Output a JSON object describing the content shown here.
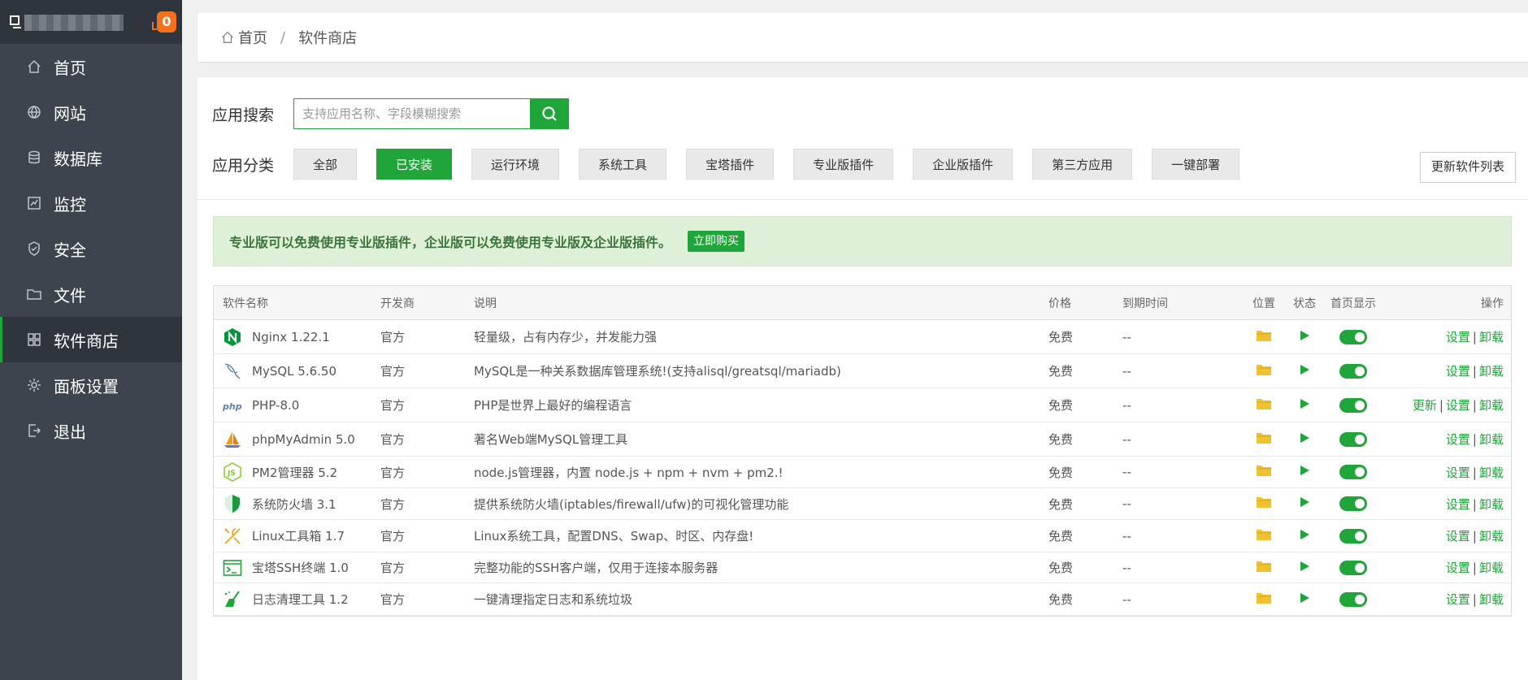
{
  "sidebar": {
    "notification_count": "0",
    "items": [
      {
        "label": "首页",
        "icon": "home-icon"
      },
      {
        "label": "网站",
        "icon": "globe-icon"
      },
      {
        "label": "数据库",
        "icon": "database-icon"
      },
      {
        "label": "监控",
        "icon": "monitor-chart-icon"
      },
      {
        "label": "安全",
        "icon": "shield-icon"
      },
      {
        "label": "文件",
        "icon": "folder-icon"
      },
      {
        "label": "软件商店",
        "icon": "grid-icon"
      },
      {
        "label": "面板设置",
        "icon": "gear-icon"
      },
      {
        "label": "退出",
        "icon": "logout-icon"
      }
    ],
    "active_index": 6
  },
  "breadcrumb": {
    "home": "首页",
    "separator": "/",
    "current": "软件商店"
  },
  "search": {
    "label": "应用搜索",
    "placeholder": "支持应用名称、字段模糊搜索"
  },
  "categories": {
    "label": "应用分类",
    "items": [
      "全部",
      "已安装",
      "运行环境",
      "系统工具",
      "宝塔插件",
      "专业版插件",
      "企业版插件",
      "第三方应用",
      "一键部署"
    ],
    "active_index": 1
  },
  "update_button": "更新软件列表",
  "notice": {
    "text": "专业版可以免费使用专业版插件，企业版可以免费使用专业版及企业版插件。",
    "button": "立即购买"
  },
  "table": {
    "headers": {
      "name": "软件名称",
      "developer": "开发商",
      "description": "说明",
      "price": "价格",
      "expire": "到期时间",
      "location": "位置",
      "status": "状态",
      "home": "首页显示",
      "ops": "操作"
    },
    "rows": [
      {
        "name": "Nginx 1.22.1",
        "developer": "官方",
        "description": "轻量级，占有内存少，并发能力强",
        "price": "免费",
        "expire": "--",
        "ops": [
          "设置",
          "卸载"
        ],
        "icon": "nginx-icon"
      },
      {
        "name": "MySQL 5.6.50",
        "developer": "官方",
        "description": "MySQL是一种关系数据库管理系统!(支持alisql/greatsql/mariadb)",
        "price": "免费",
        "expire": "--",
        "ops": [
          "设置",
          "卸载"
        ],
        "icon": "mysql-dolphin-icon"
      },
      {
        "name": "PHP-8.0",
        "developer": "官方",
        "description": "PHP是世界上最好的编程语言",
        "price": "免费",
        "expire": "--",
        "ops": [
          "更新",
          "设置",
          "卸载"
        ],
        "icon": "php-icon"
      },
      {
        "name": "phpMyAdmin 5.0",
        "developer": "官方",
        "description": "著名Web端MySQL管理工具",
        "price": "免费",
        "expire": "--",
        "ops": [
          "设置",
          "卸载"
        ],
        "icon": "phpmyadmin-sailboat-icon"
      },
      {
        "name": "PM2管理器 5.2",
        "developer": "官方",
        "description": "node.js管理器，内置 node.js + npm + nvm + pm2.!",
        "price": "免费",
        "expire": "--",
        "ops": [
          "设置",
          "卸载"
        ],
        "icon": "nodejs-icon"
      },
      {
        "name": "系统防火墙 3.1",
        "developer": "官方",
        "description": "提供系统防火墙(iptables/firewall/ufw)的可视化管理功能",
        "price": "免费",
        "expire": "--",
        "ops": [
          "设置",
          "卸载"
        ],
        "icon": "firewall-shield-icon"
      },
      {
        "name": "Linux工具箱 1.7",
        "developer": "官方",
        "description": "Linux系统工具，配置DNS、Swap、时区、内存盘!",
        "price": "免费",
        "expire": "--",
        "ops": [
          "设置",
          "卸载"
        ],
        "icon": "tools-icon"
      },
      {
        "name": "宝塔SSH终端 1.0",
        "developer": "官方",
        "description": "完整功能的SSH客户端，仅用于连接本服务器",
        "price": "免费",
        "expire": "--",
        "ops": [
          "设置",
          "卸载"
        ],
        "icon": "terminal-icon"
      },
      {
        "name": "日志清理工具 1.2",
        "developer": "官方",
        "description": "一键清理指定日志和系统垃圾",
        "price": "免费",
        "expire": "--",
        "ops": [
          "设置",
          "卸载"
        ],
        "icon": "broom-icon"
      }
    ]
  },
  "colors": {
    "accent": "#20a53a",
    "sidebar_bg": "#3c444d",
    "sidebar_top": "#2e353d",
    "badge": "#f2711c",
    "folder": "#f0c232"
  }
}
